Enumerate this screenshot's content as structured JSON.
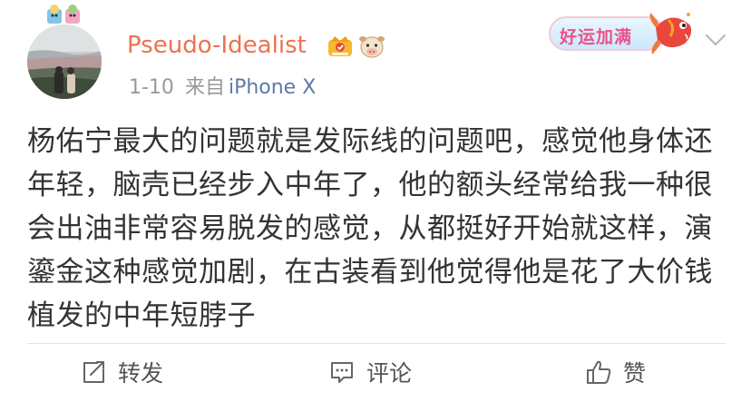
{
  "post": {
    "author": {
      "name": "Pseudo-Idealist",
      "vip_icon": "crown-vip-icon",
      "pet_icon": "pet-cow-icon"
    },
    "time": "1-10",
    "source_prefix": "来自",
    "source_device": "iPhone X",
    "luck_badge": "好运加满",
    "content": "杨佑宁最大的问题就是发际线的问题吧，感觉他身体还年轻，脑壳已经步入中年了，他的额头经常给我一种很会出油非常容易脱发的感觉，从都挺好开始就这样，演鎏金这种感觉加剧，在古装看到他觉得他是花了大价钱植发的中年短脖子"
  },
  "actions": {
    "repost": "转发",
    "comment": "评论",
    "like": "赞"
  },
  "colors": {
    "username": "#eb7350",
    "device_link": "#5b7aa8",
    "secondary_text": "#999999"
  }
}
